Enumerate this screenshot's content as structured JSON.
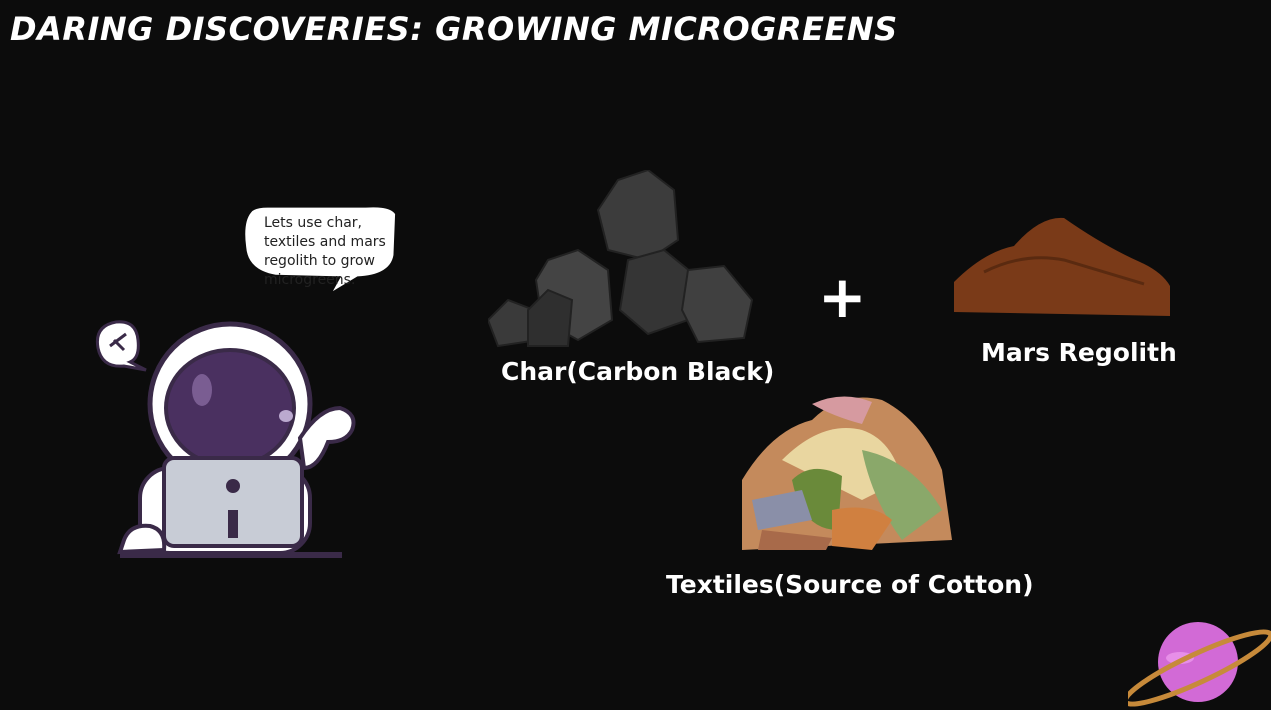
{
  "slide": {
    "title": "DARING DISCOVERIES: GROWING MICROGREENS",
    "speech_bubble": "Lets use char, textiles and mars regolith to grow microgreens.",
    "plus_symbol": "+",
    "items": [
      {
        "label": "Char(Carbon Black)"
      },
      {
        "label": "Mars Regolith"
      },
      {
        "label": "Textiles(Source of Cotton)"
      }
    ]
  },
  "colors": {
    "background": "#0c0c0c",
    "text": "#ffffff",
    "astronaut_visor": "#3b2a55",
    "regolith": "#7a3a18",
    "planet": "#d26ad6"
  }
}
